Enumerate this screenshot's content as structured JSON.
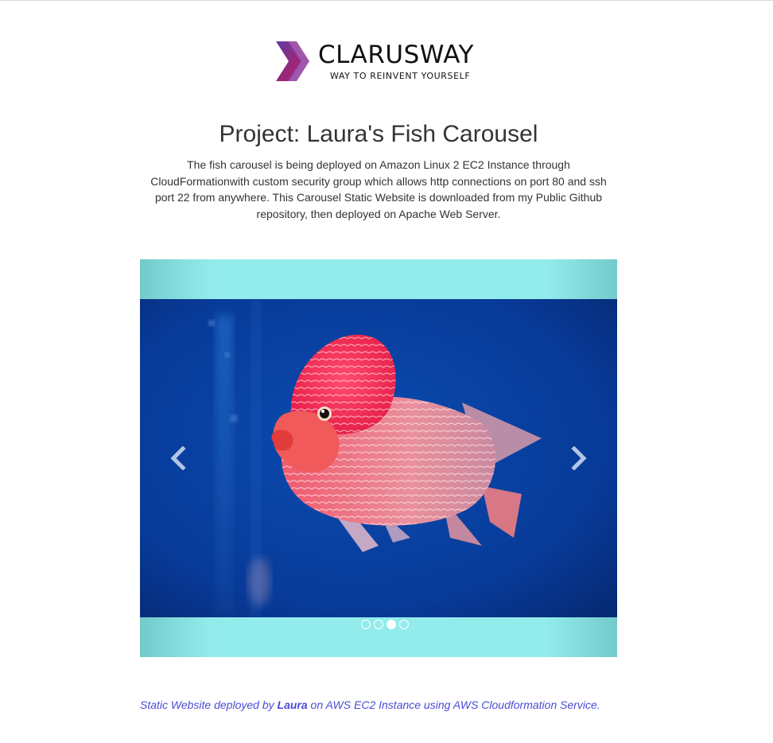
{
  "logo": {
    "name": "CLARUSWAY",
    "tagline": "WAY TO REINVENT YOURSELF",
    "icon": "double-chevron-logo-icon",
    "colors": [
      "#7b3fa0",
      "#c2185b"
    ]
  },
  "page": {
    "title": "Project: Laura's Fish Carousel",
    "description": "The fish carousel is being deployed on Amazon Linux 2 EC2 Instance through CloudFormationwith custom security group which allows http connections on port 80 and ssh port 22 from anywhere. This Carousel Static Website is downloaded from my Public Github repository, then deployed on Apache Web Server."
  },
  "carousel": {
    "background_color": "#93ecec",
    "slide_count": 4,
    "active_index": 2,
    "prev_icon": "chevron-left-icon",
    "next_icon": "chevron-right-icon"
  },
  "footer": {
    "prefix": "Static Website deployed by ",
    "name": "Laura",
    "suffix": " on AWS EC2 Instance using AWS Cloudformation Service.",
    "color": "#4b4bd6"
  }
}
